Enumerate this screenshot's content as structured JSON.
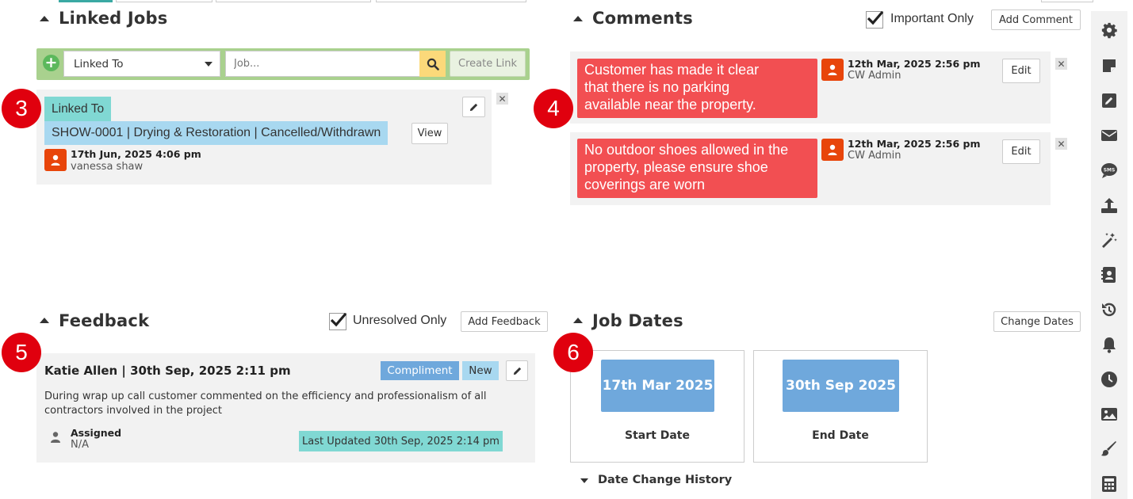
{
  "linked_jobs": {
    "title": "Linked Jobs",
    "link_type_value": "Linked To",
    "job_placeholder": "Job...",
    "create_link_label": "Create Link",
    "item": {
      "tag": "Linked To",
      "job": "SHOW-0001 | Drying & Restoration | Cancelled/Withdrawn",
      "view_label": "View",
      "date": "17th Jun, 2025 4:06 pm",
      "user": "vanessa shaw"
    }
  },
  "comments": {
    "title": "Comments",
    "important_only_label": "Important Only",
    "add_comment_label": "Add Comment",
    "items": [
      {
        "lines": [
          "Customer has made it clear",
          "that there is no parking",
          "available near the property."
        ],
        "date": "12th Mar, 2025 2:56 pm",
        "user": "CW Admin",
        "edit_label": "Edit"
      },
      {
        "lines": [
          "No outdoor shoes allowed in the",
          "property, please ensure shoe",
          "coverings are worn"
        ],
        "date": "12th Mar, 2025 2:56 pm",
        "user": "CW Admin",
        "edit_label": "Edit"
      }
    ]
  },
  "feedback": {
    "title": "Feedback",
    "unresolved_only_label": "Unresolved Only",
    "add_feedback_label": "Add Feedback",
    "item": {
      "header": "Katie Allen | 30th Sep, 2025 2:11 pm",
      "type_badge": "Compliment",
      "status_badge": "New",
      "body": "During wrap up call customer commented on the efficiency and professionalism of all contractors involved in the project",
      "assigned_label": "Assigned",
      "assigned_value": "N/A",
      "last_updated": "Last Updated 30th Sep, 2025 2:14 pm"
    }
  },
  "job_dates": {
    "title": "Job Dates",
    "change_dates_label": "Change Dates",
    "start_date": "17th Mar 2025",
    "start_label": "Start Date",
    "end_date": "30th Sep 2025",
    "end_label": "End Date",
    "history_label": "Date Change History"
  },
  "callouts": [
    "3",
    "4",
    "5",
    "6"
  ],
  "colors": {
    "accent_green": "#a9d18e",
    "comment_red": "#f24f52",
    "date_blue": "#6fa8dc",
    "tag_teal": "#80d8d3",
    "tag_blue": "#a8d8f0",
    "callout_red": "#e0000e",
    "avatar_orange": "#e8450a"
  },
  "sidebar_icons": [
    "gear-icon",
    "note-icon",
    "edit-icon",
    "envelope-icon",
    "sms-icon",
    "upload-icon",
    "magic-wand-icon",
    "contact-book-icon",
    "history-icon",
    "bell-icon",
    "clock-icon",
    "image-icon",
    "brush-icon",
    "calculator-icon"
  ]
}
